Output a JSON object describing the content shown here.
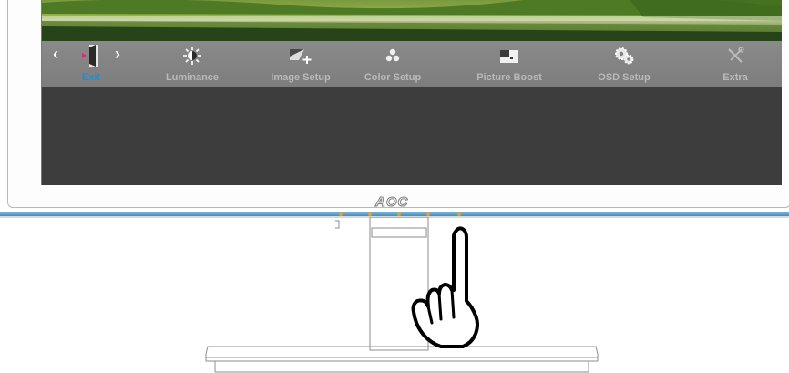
{
  "osd": {
    "items": [
      {
        "label": "Exit",
        "icon": "exit-icon",
        "active": true
      },
      {
        "label": "Luminance",
        "icon": "sun-icon",
        "active": false
      },
      {
        "label": "Image Setup",
        "icon": "image-setup-icon",
        "active": false
      },
      {
        "label": "Color Setup",
        "icon": "color-dots-icon",
        "active": false
      },
      {
        "label": "Picture Boost",
        "icon": "picture-boost-icon",
        "active": false
      },
      {
        "label": "OSD Setup",
        "icon": "gears-icon",
        "active": false
      },
      {
        "label": "Extra",
        "icon": "tools-icon",
        "active": false
      }
    ],
    "nav_left": "‹",
    "nav_right": "›",
    "colors": {
      "active_label": "#1e8fd6",
      "inactive_label": "#b9b9b9",
      "bar": "#828282",
      "content": "#3d3d3d"
    }
  },
  "monitor": {
    "logo": "AOC",
    "bezel_accent": "#3f8dc2",
    "key_light": "#d9a23c"
  }
}
